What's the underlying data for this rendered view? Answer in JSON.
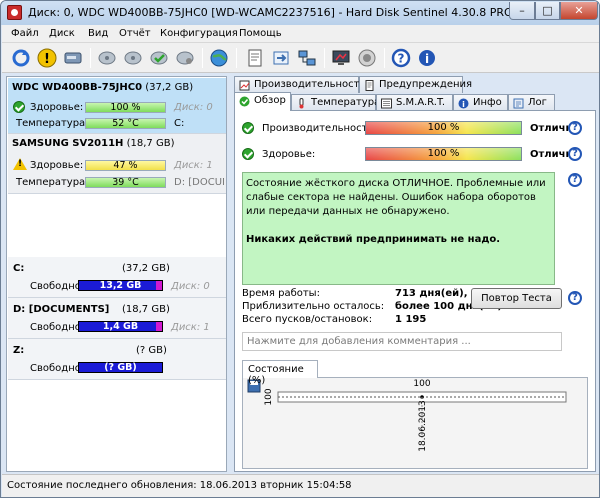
{
  "window": {
    "title": "Диск: 0, WDC WD400BB-75JHC0 [WD-WCAMC2237516]  -  Hard Disk Sentinel 4.30.8 PRO",
    "min": "–",
    "max": "□",
    "close": "✕"
  },
  "menu": [
    "Файл",
    "Диск",
    "Вид",
    "Отчёт",
    "Конфигурация",
    "Помощь"
  ],
  "disks": [
    {
      "name_bold": "WDC WD400BB-75JHC0",
      "size": "(37,2 GB)",
      "health_label": "Здоровье:",
      "health": "100 %",
      "disk_label": "Диск: 0",
      "temp_label": "Температура:",
      "temp": "52 °C",
      "drive": "C:"
    },
    {
      "name_bold": "SAMSUNG SV2011H",
      "size": "(18,7 GB)",
      "health_label": "Здоровье:",
      "health": "47 %",
      "disk_label": "Диск: 1",
      "temp_label": "Температура:",
      "temp": "39 °C",
      "drive": "D: [DOCUMENTS]"
    }
  ],
  "partitions": [
    {
      "name": "C:",
      "size": "(37,2 GB)",
      "free_label": "Свободно",
      "free": "13,2 GB",
      "disk": "Диск: 0"
    },
    {
      "name": "D: [DOCUMENTS]",
      "size": "(18,7 GB)",
      "free_label": "Свободно",
      "free": "1,4 GB",
      "disk": "Диск: 1"
    },
    {
      "name": "Z:",
      "size": "(? GB)",
      "free_label": "Свободно",
      "free": "(? GB)",
      "disk": ""
    }
  ],
  "tabs_top": [
    "Производительность",
    "Предупреждения"
  ],
  "tabs_bottom": [
    "Обзор",
    "Температура",
    "S.M.A.R.T.",
    "Инфо",
    "Лог"
  ],
  "overview": {
    "perf_label": "Производительность:",
    "perf_value": "100 %",
    "perf_status": "Отлично",
    "health_label": "Здоровье:",
    "health_value": "100 %",
    "health_status": "Отлично",
    "info_text": "Состояние жёсткого диска ОТЛИЧНОЕ. Проблемные или слабые сектора не найдены. Ошибок набора оборотов или передачи данных не обнаружено.",
    "info_strong": "Никаких действий предпринимать не надо.",
    "uptime_label": "Время работы:",
    "uptime_value": "713 дня(ей), 5 ча",
    "remaining_label": "Приблизительно осталось:",
    "remaining_value": "более 100 дня(ей)",
    "starts_label": "Всего пусков/остановок:",
    "starts_value": "1 195",
    "retest_button": "Повтор Теста",
    "comment_placeholder": "Нажмите для добавления комментария ...",
    "chart_tab": "Состояние (%)"
  },
  "chart_data": {
    "type": "line",
    "x": [
      "18.06.2013"
    ],
    "series": [
      {
        "values": [
          100
        ]
      }
    ],
    "ylim": [
      100,
      100
    ],
    "y_tick_labels": [
      "100"
    ],
    "data_labels": [
      "100"
    ],
    "xlabel": "",
    "ylabel": ""
  },
  "status_bar": "Состояние последнего обновления: 18.06.2013 вторник 15:04:58",
  "colors": {
    "ok_green": "#2ea42e",
    "warn_yellow": "#f2c200",
    "selected": "#bfe0f7",
    "info_bg": "#c2f5c2",
    "free_blue": "#1b1bd6",
    "accent_blue": "#2356b5"
  }
}
